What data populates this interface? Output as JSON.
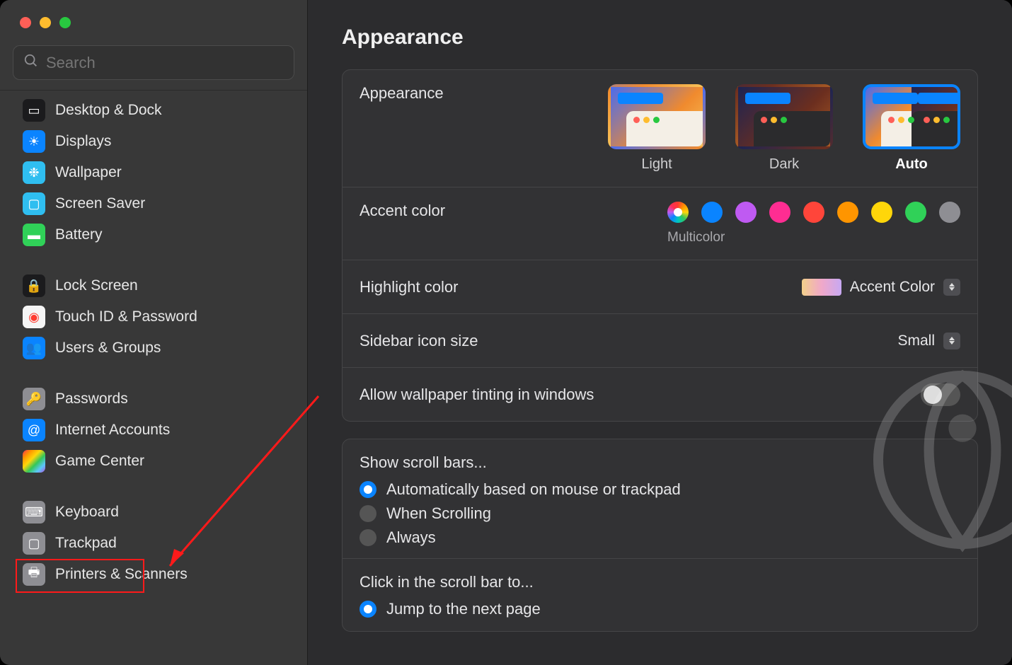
{
  "search": {
    "placeholder": "Search"
  },
  "sidebar": {
    "groups": [
      [
        {
          "label": "Desktop & Dock"
        },
        {
          "label": "Displays"
        },
        {
          "label": "Wallpaper"
        },
        {
          "label": "Screen Saver"
        },
        {
          "label": "Battery"
        }
      ],
      [
        {
          "label": "Lock Screen"
        },
        {
          "label": "Touch ID & Password"
        },
        {
          "label": "Users & Groups"
        }
      ],
      [
        {
          "label": "Passwords"
        },
        {
          "label": "Internet Accounts"
        },
        {
          "label": "Game Center"
        }
      ],
      [
        {
          "label": "Keyboard"
        },
        {
          "label": "Trackpad"
        },
        {
          "label": "Printers & Scanners"
        }
      ]
    ]
  },
  "page": {
    "title": "Appearance",
    "appearance": {
      "label": "Appearance",
      "options": [
        "Light",
        "Dark",
        "Auto"
      ],
      "selected": "Auto"
    },
    "accent": {
      "label": "Accent color",
      "selected_caption": "Multicolor",
      "colors": [
        "multi",
        "#0a84ff",
        "#bf5af2",
        "#ff2d92",
        "#ff453a",
        "#ff9500",
        "#ffd60a",
        "#30d158",
        "#8e8e93"
      ],
      "selected_index": 0
    },
    "highlight": {
      "label": "Highlight color",
      "value": "Accent Color"
    },
    "sidebar_icon": {
      "label": "Sidebar icon size",
      "value": "Small"
    },
    "tinting": {
      "label": "Allow wallpaper tinting in windows",
      "on": false
    },
    "scrollbars": {
      "heading": "Show scroll bars...",
      "options": [
        "Automatically based on mouse or trackpad",
        "When Scrolling",
        "Always"
      ],
      "selected_index": 0
    },
    "click_scroll": {
      "heading": "Click in the scroll bar to...",
      "options": [
        "Jump to the next page"
      ],
      "selected_index": 0
    }
  }
}
